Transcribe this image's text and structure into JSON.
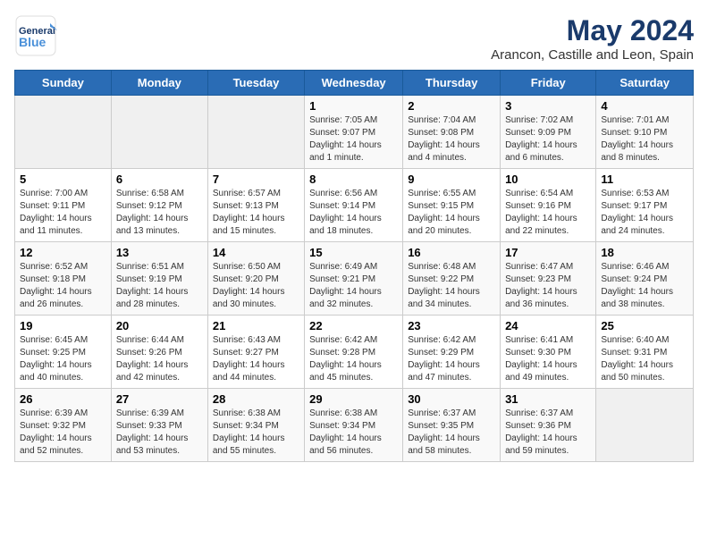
{
  "header": {
    "logo_line1": "General",
    "logo_line2": "Blue",
    "month": "May 2024",
    "location": "Arancon, Castille and Leon, Spain"
  },
  "weekdays": [
    "Sunday",
    "Monday",
    "Tuesday",
    "Wednesday",
    "Thursday",
    "Friday",
    "Saturday"
  ],
  "weeks": [
    [
      {
        "day": "",
        "info": ""
      },
      {
        "day": "",
        "info": ""
      },
      {
        "day": "",
        "info": ""
      },
      {
        "day": "1",
        "info": "Sunrise: 7:05 AM\nSunset: 9:07 PM\nDaylight: 14 hours\nand 1 minute."
      },
      {
        "day": "2",
        "info": "Sunrise: 7:04 AM\nSunset: 9:08 PM\nDaylight: 14 hours\nand 4 minutes."
      },
      {
        "day": "3",
        "info": "Sunrise: 7:02 AM\nSunset: 9:09 PM\nDaylight: 14 hours\nand 6 minutes."
      },
      {
        "day": "4",
        "info": "Sunrise: 7:01 AM\nSunset: 9:10 PM\nDaylight: 14 hours\nand 8 minutes."
      }
    ],
    [
      {
        "day": "5",
        "info": "Sunrise: 7:00 AM\nSunset: 9:11 PM\nDaylight: 14 hours\nand 11 minutes."
      },
      {
        "day": "6",
        "info": "Sunrise: 6:58 AM\nSunset: 9:12 PM\nDaylight: 14 hours\nand 13 minutes."
      },
      {
        "day": "7",
        "info": "Sunrise: 6:57 AM\nSunset: 9:13 PM\nDaylight: 14 hours\nand 15 minutes."
      },
      {
        "day": "8",
        "info": "Sunrise: 6:56 AM\nSunset: 9:14 PM\nDaylight: 14 hours\nand 18 minutes."
      },
      {
        "day": "9",
        "info": "Sunrise: 6:55 AM\nSunset: 9:15 PM\nDaylight: 14 hours\nand 20 minutes."
      },
      {
        "day": "10",
        "info": "Sunrise: 6:54 AM\nSunset: 9:16 PM\nDaylight: 14 hours\nand 22 minutes."
      },
      {
        "day": "11",
        "info": "Sunrise: 6:53 AM\nSunset: 9:17 PM\nDaylight: 14 hours\nand 24 minutes."
      }
    ],
    [
      {
        "day": "12",
        "info": "Sunrise: 6:52 AM\nSunset: 9:18 PM\nDaylight: 14 hours\nand 26 minutes."
      },
      {
        "day": "13",
        "info": "Sunrise: 6:51 AM\nSunset: 9:19 PM\nDaylight: 14 hours\nand 28 minutes."
      },
      {
        "day": "14",
        "info": "Sunrise: 6:50 AM\nSunset: 9:20 PM\nDaylight: 14 hours\nand 30 minutes."
      },
      {
        "day": "15",
        "info": "Sunrise: 6:49 AM\nSunset: 9:21 PM\nDaylight: 14 hours\nand 32 minutes."
      },
      {
        "day": "16",
        "info": "Sunrise: 6:48 AM\nSunset: 9:22 PM\nDaylight: 14 hours\nand 34 minutes."
      },
      {
        "day": "17",
        "info": "Sunrise: 6:47 AM\nSunset: 9:23 PM\nDaylight: 14 hours\nand 36 minutes."
      },
      {
        "day": "18",
        "info": "Sunrise: 6:46 AM\nSunset: 9:24 PM\nDaylight: 14 hours\nand 38 minutes."
      }
    ],
    [
      {
        "day": "19",
        "info": "Sunrise: 6:45 AM\nSunset: 9:25 PM\nDaylight: 14 hours\nand 40 minutes."
      },
      {
        "day": "20",
        "info": "Sunrise: 6:44 AM\nSunset: 9:26 PM\nDaylight: 14 hours\nand 42 minutes."
      },
      {
        "day": "21",
        "info": "Sunrise: 6:43 AM\nSunset: 9:27 PM\nDaylight: 14 hours\nand 44 minutes."
      },
      {
        "day": "22",
        "info": "Sunrise: 6:42 AM\nSunset: 9:28 PM\nDaylight: 14 hours\nand 45 minutes."
      },
      {
        "day": "23",
        "info": "Sunrise: 6:42 AM\nSunset: 9:29 PM\nDaylight: 14 hours\nand 47 minutes."
      },
      {
        "day": "24",
        "info": "Sunrise: 6:41 AM\nSunset: 9:30 PM\nDaylight: 14 hours\nand 49 minutes."
      },
      {
        "day": "25",
        "info": "Sunrise: 6:40 AM\nSunset: 9:31 PM\nDaylight: 14 hours\nand 50 minutes."
      }
    ],
    [
      {
        "day": "26",
        "info": "Sunrise: 6:39 AM\nSunset: 9:32 PM\nDaylight: 14 hours\nand 52 minutes."
      },
      {
        "day": "27",
        "info": "Sunrise: 6:39 AM\nSunset: 9:33 PM\nDaylight: 14 hours\nand 53 minutes."
      },
      {
        "day": "28",
        "info": "Sunrise: 6:38 AM\nSunset: 9:34 PM\nDaylight: 14 hours\nand 55 minutes."
      },
      {
        "day": "29",
        "info": "Sunrise: 6:38 AM\nSunset: 9:34 PM\nDaylight: 14 hours\nand 56 minutes."
      },
      {
        "day": "30",
        "info": "Sunrise: 6:37 AM\nSunset: 9:35 PM\nDaylight: 14 hours\nand 58 minutes."
      },
      {
        "day": "31",
        "info": "Sunrise: 6:37 AM\nSunset: 9:36 PM\nDaylight: 14 hours\nand 59 minutes."
      },
      {
        "day": "",
        "info": ""
      }
    ]
  ]
}
